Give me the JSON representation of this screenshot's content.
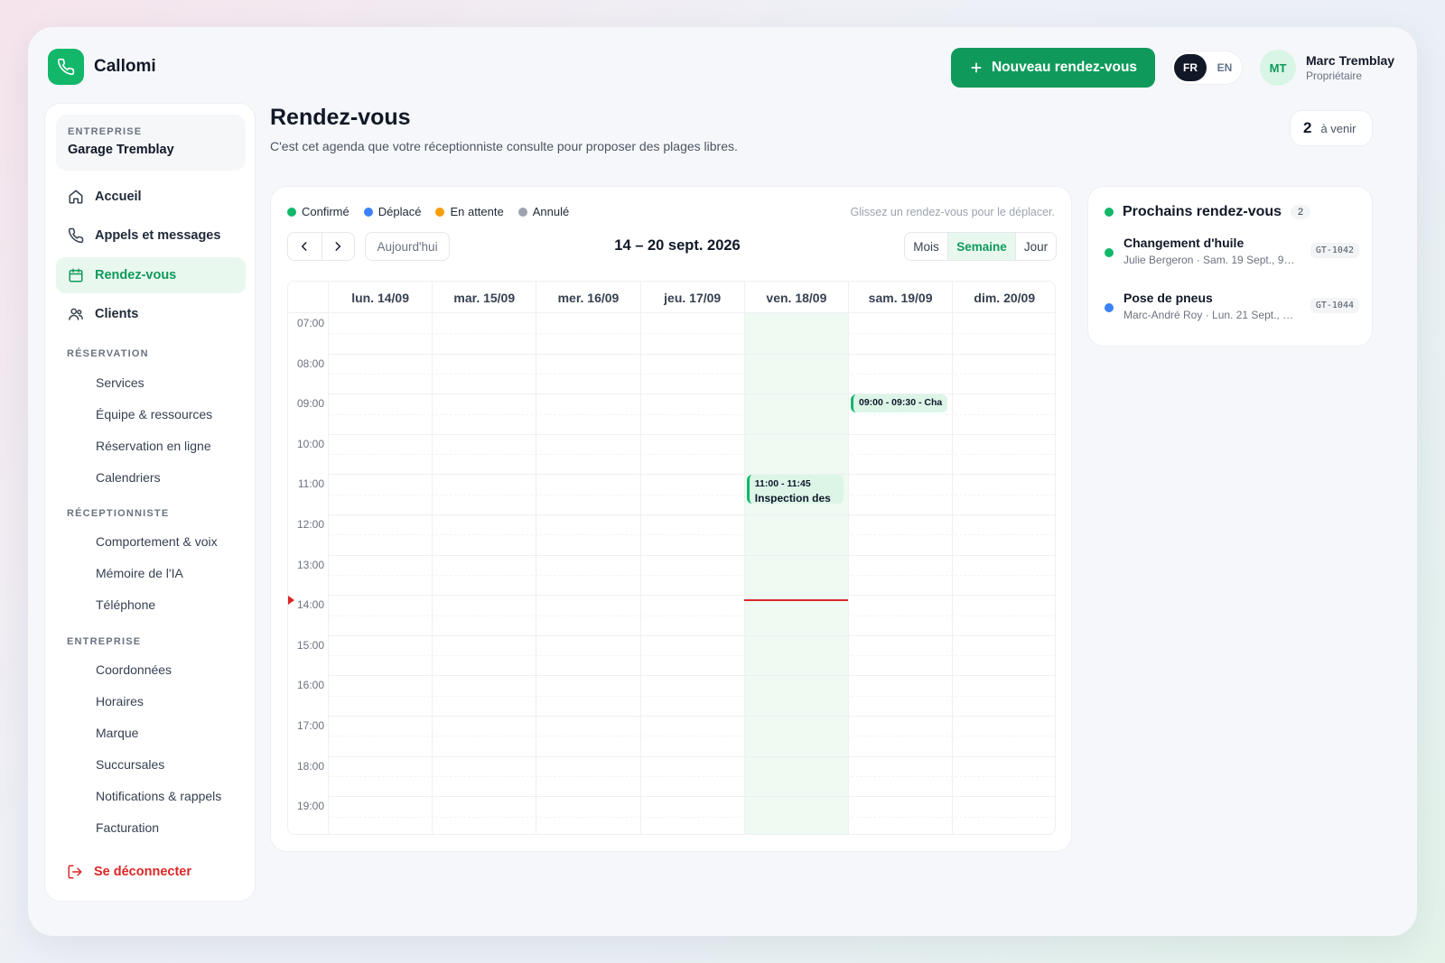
{
  "app": {
    "name": "Callomi",
    "logo_icon": "phone-icon",
    "accent": "#12b76a"
  },
  "header": {
    "new_button_label": "Nouveau rendez-vous",
    "languages": [
      "FR",
      "EN"
    ],
    "active_language": "FR",
    "user": {
      "initials": "MT",
      "name": "Marc Tremblay",
      "role": "Propriétaire"
    }
  },
  "sidebar": {
    "company_label": "ENTREPRISE",
    "company_name": "Garage Tremblay",
    "main_items": [
      {
        "label": "Accueil",
        "icon": "home-icon"
      },
      {
        "label": "Appels et messages",
        "icon": "phone-icon"
      },
      {
        "label": "Rendez-vous",
        "icon": "calendar-icon",
        "active": true
      },
      {
        "label": "Clients",
        "icon": "users-icon"
      }
    ],
    "sections": [
      {
        "title": "RÉSERVATION",
        "items": [
          "Services",
          "Équipe & ressources",
          "Réservation en ligne",
          "Calendriers"
        ]
      },
      {
        "title": "RÉCEPTIONNISTE",
        "items": [
          "Comportement & voix",
          "Mémoire de l'IA",
          "Téléphone"
        ]
      },
      {
        "title": "ENTREPRISE",
        "items": [
          "Coordonnées",
          "Horaires",
          "Marque",
          "Succursales",
          "Notifications & rappels",
          "Facturation"
        ]
      }
    ],
    "logout_label": "Se déconnecter"
  },
  "page": {
    "title": "Rendez-vous",
    "subtitle": "C'est cet agenda que votre réceptionniste consulte pour proposer des plages libres.",
    "upcoming_count": "2",
    "upcoming_label": "à venir"
  },
  "calendar": {
    "legend": [
      {
        "label": "Confirmé",
        "color": "#12b76a"
      },
      {
        "label": "Déplacé",
        "color": "#3b82f6"
      },
      {
        "label": "En attente",
        "color": "#f59e0b"
      },
      {
        "label": "Annulé",
        "color": "#9ca3af"
      }
    ],
    "hint": "Glissez un rendez-vous pour le déplacer.",
    "today_label": "Aujourd'hui",
    "range": "14 – 20 sept. 2026",
    "views": [
      "Mois",
      "Semaine",
      "Jour"
    ],
    "active_view": "Semaine",
    "days": [
      "lun. 14/09",
      "mar. 15/09",
      "mer. 16/09",
      "jeu. 17/09",
      "ven. 18/09",
      "sam. 19/09",
      "dim. 20/09"
    ],
    "highlighted_day": 4,
    "hours": [
      "07:00",
      "08:00",
      "09:00",
      "10:00",
      "11:00",
      "12:00",
      "13:00",
      "14:00",
      "15:00",
      "16:00",
      "17:00",
      "18:00",
      "19:00"
    ],
    "events": [
      {
        "day": 5,
        "start": 9.0,
        "end": 9.5,
        "label": "09:00 - 09:30 - Cha"
      },
      {
        "day": 4,
        "start": 11.0,
        "end": 11.75,
        "label_time": "11:00 - 11:45",
        "label_title": "Inspection des"
      }
    ],
    "now": {
      "day": 4,
      "time": 14.1
    }
  },
  "upcoming": {
    "title": "Prochains rendez-vous",
    "count": "2",
    "items": [
      {
        "name": "Changement d'huile",
        "meta": "Julie Bergeron · Sam. 19 Sept., 9 ...",
        "code": "GT-1042",
        "color": "#12b76a"
      },
      {
        "name": "Pose de pneus",
        "meta": "Marc-André Roy · Lun. 21 Sept., 9...",
        "code": "GT-1044",
        "color": "#3b82f6"
      }
    ]
  }
}
